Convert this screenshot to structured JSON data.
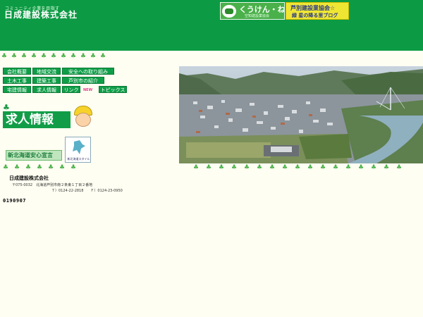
{
  "header": {
    "tagline": "コミュニティ企業を目指す",
    "company_logo": "日成建設株式会社"
  },
  "banners": {
    "kuuken_title": "くうけん・ねっと",
    "kuuken_sub": "空知建設業協会",
    "blog_line1": "芦別建設業協会☆",
    "blog_line2": "緑 星の降る里ブログ"
  },
  "nav": {
    "items": [
      {
        "label": "会社概要"
      },
      {
        "label": "地域交流"
      },
      {
        "label": "安全への取り組み"
      },
      {
        "label": "土木工事"
      },
      {
        "label": "建築工事"
      },
      {
        "label": "芦別市の紹介"
      },
      {
        "label": "宅建情報"
      },
      {
        "label": "求人情報"
      },
      {
        "label": "リンク"
      },
      {
        "label": "トピックス"
      }
    ],
    "new_badge": "NEW"
  },
  "promo": {
    "kyujin_label": "求人情報",
    "anshin_label": "新北海道安心宣言",
    "hokkaido_logo_label": "新北海道スタイル"
  },
  "footer": {
    "company_name": "日成建設株式会社",
    "address": "〒075-0032　北海道芦別市南２条東１丁目２番地",
    "tel": "Ｔ）0124-22-2818　　Ｆ）0124-23-0950",
    "counter": "0190907"
  },
  "colors": {
    "header_green": "#0c9b44",
    "nav_green": "#0f9e48",
    "page_bg": "#fffef2"
  }
}
